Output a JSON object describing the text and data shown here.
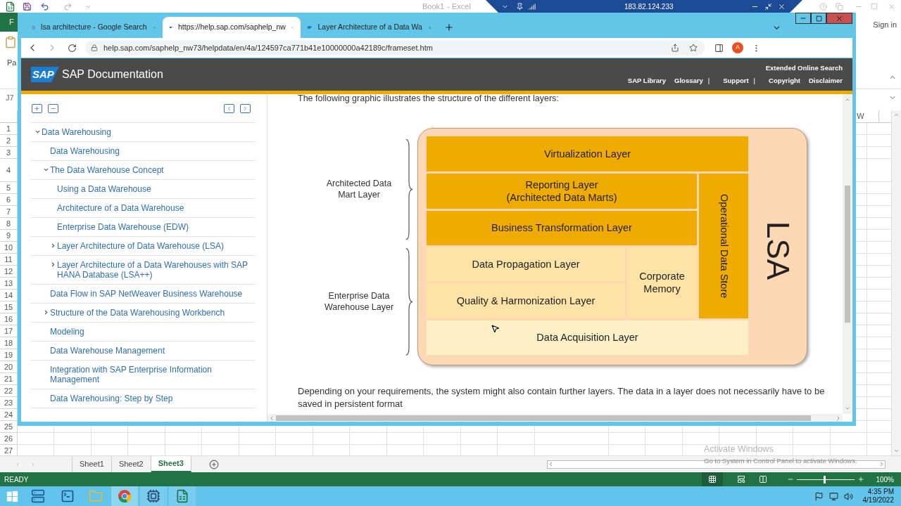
{
  "excel": {
    "title": "Book1",
    "title_suffix": "- Excel",
    "file_tab": "F",
    "paste_label": "Pa",
    "name_box": "J7",
    "sign_in": "Sign in",
    "column_header": "W",
    "row_numbers": [
      "1",
      "2",
      "3",
      "4",
      "5",
      "6",
      "7",
      "8",
      "9",
      "10",
      "11",
      "12",
      "13",
      "14",
      "15",
      "16",
      "17",
      "18",
      "19",
      "20",
      "21",
      "22",
      "23",
      "24",
      "25",
      "26",
      "27"
    ],
    "sheets": [
      {
        "label": "Sheet1",
        "selected": false
      },
      {
        "label": "Sheet2",
        "selected": false
      },
      {
        "label": "Sheet3",
        "selected": true
      }
    ],
    "status": "READY",
    "zoom": "100%",
    "zoom_slider": {
      "level": 0.5
    }
  },
  "remote_bar": {
    "address": "183.82.124.233"
  },
  "browser": {
    "tabs": [
      {
        "kind": "google",
        "title": "lsa architecture - Google Search",
        "selected": false
      },
      {
        "kind": "sap",
        "title": "https://help.sap.com/saphelp_nw",
        "selected": true
      },
      {
        "kind": "sap",
        "title": "Layer Architecture of a Data Wa",
        "selected": false
      }
    ],
    "url": "help.sap.com/saphelp_nw73/helpdata/en/4a/124597ca771b41e10000000a42189c/frameset.htm",
    "avatar": "A",
    "site": {
      "logo": "SAP",
      "title": "SAP Documentation",
      "search_link": "Extended Online Search",
      "nav": [
        {
          "kind": "link",
          "label": "SAP Library"
        },
        {
          "kind": "link",
          "label": "Glossary"
        },
        {
          "kind": "separator",
          "label": "|"
        },
        {
          "kind": "link",
          "label": "Support"
        },
        {
          "kind": "separator",
          "label": "|"
        },
        {
          "kind": "link",
          "label": "Copyright"
        },
        {
          "kind": "link",
          "label": "Disclaimer"
        }
      ]
    },
    "toc": [
      {
        "label": "Data Warehousing",
        "expanded": true,
        "children": [
          {
            "label": "Data Warehousing"
          },
          {
            "label": "The Data Warehouse Concept",
            "expanded": true,
            "children": [
              {
                "label": "Using a Data Warehouse"
              },
              {
                "label": "Architecture of a Data Warehouse"
              },
              {
                "label": "Enterprise Data Warehouse (EDW)"
              },
              {
                "label": "Layer Architecture of Data Warehouse (LSA)",
                "expanded": false
              },
              {
                "label": "Layer Architecture of a Data Warehouses with SAP HANA Database (LSA++)",
                "expanded": false
              }
            ]
          },
          {
            "label": "Data Flow in SAP NetWeaver Business Warehouse"
          },
          {
            "label": "Structure of the Data Warehousing Workbench",
            "expanded": false
          },
          {
            "label": "Modeling"
          },
          {
            "label": "Data Warehouse Management"
          },
          {
            "label": "Integration with SAP Enterprise Information Management"
          },
          {
            "label": "Data Warehousing: Step by Step"
          }
        ]
      }
    ],
    "content": {
      "intro": "The following graphic illustrates the structure of the different layers:",
      "diagram": {
        "side_labels": [
          "Architected Data Mart Layer",
          "Enterprise Data Warehouse Layer"
        ],
        "layers": [
          {
            "label": "Virtualization Layer",
            "color": "#f0ab00"
          },
          {
            "label": "Reporting Layer",
            "sublabel": "(Architected Data Marts)",
            "color": "#f0ab00"
          },
          {
            "label": "Business Transformation Layer",
            "color": "#f0ab00"
          },
          {
            "label": "Operational Data Store",
            "color": "#f0ab00"
          },
          {
            "label": "Data Propagation Layer",
            "color": "#fde3a5"
          },
          {
            "label": "Quality & Harmonization Layer",
            "color": "#fde3a5"
          },
          {
            "label": "Corporate Memory",
            "color": "#fde3a5"
          },
          {
            "label": "Data Acquisition Layer",
            "color": "#fdefc6"
          }
        ],
        "title": "LSA"
      },
      "paragraph": "Depending on your requirements, the system might also contain further layers. The data in a layer does not necessarily have to be saved in persistent format"
    }
  },
  "taskbar": {
    "time": "4:35 PM",
    "date": "4/19/2022"
  },
  "watermark": {
    "title": "Activate Windows",
    "subtitle": "Go to System in Control Panel to activate Windows."
  }
}
